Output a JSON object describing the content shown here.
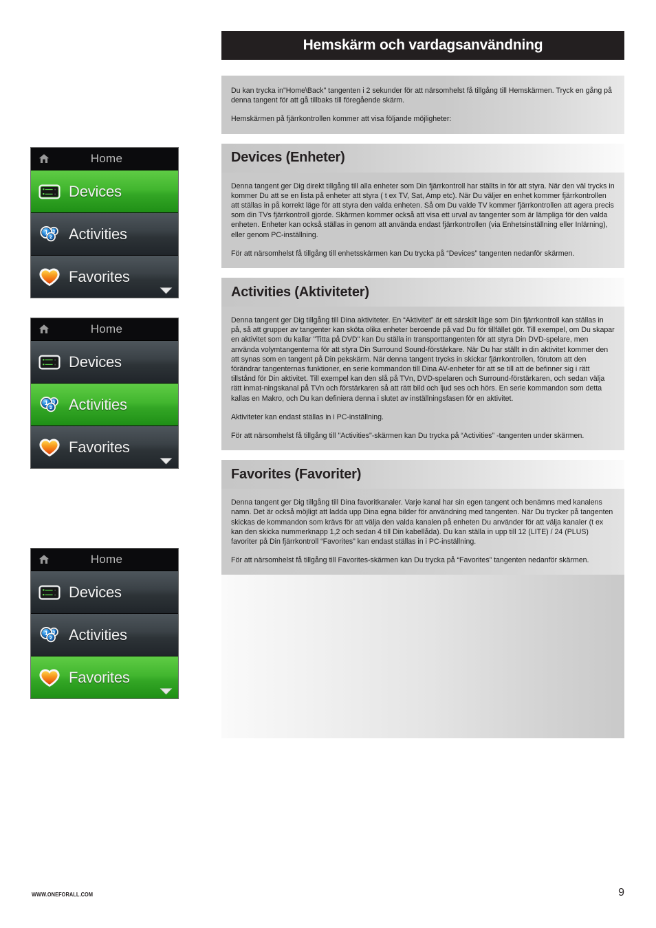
{
  "page": {
    "title": "Hemskärm och vardagsanvändning",
    "footer_url": "WWW.ONEFORALL.COM",
    "page_number": "9"
  },
  "colors": {
    "banner_bg": "#231f20",
    "panel_gray": "#c9c9c9",
    "highlight_green": "#3fb42c",
    "row_dark": "#3b4247",
    "screen_titlebar": "#0b0b0d",
    "heart_orange": "#f07c18",
    "activity_blue": "#1b7fd4",
    "led_green": "#3fd43f"
  },
  "intro": {
    "paragraphs": [
      "Du kan trycka in\"Home\\Back\"  tangenten i 2 sekunder för att närsomhelst få tillgång till Hemskärmen. Tryck en gång på denna tangent för att gå tillbaks till föregående skärm.",
      "Hemskärmen på fjärrkontrollen kommer att visa följande möjligheter:"
    ]
  },
  "sections": [
    {
      "heading": "Devices (Enheter)",
      "paragraphs": [
        "Denna tangent ger Dig direkt tillgång till alla enheter som Din fjärrkontroll har ställts in för att styra. När den väl trycks in kommer Du att se en lista på enheter att styra ( t ex TV, Sat, Amp etc). När Du väljer en enhet kommer fjärrkontrollen att ställas in på korrekt läge för att styra den valda enheten. Så om Du valde TV kommer fjärrkontrollen att agera precis som din TVs fjärrkontroll gjorde.\nSkärmen kommer också att visa ett urval av tangenter som är lämpliga för den valda enheten.\nEnheter kan också ställas in genom att använda endast fjärrkontrollen (via Enhetsinställning eller Inlärning), eller genom PC-inställning.",
        "För att närsomhelst få tillgång till enhetsskärmen kan Du trycka på “Devices”  tangenten nedanför skärmen."
      ]
    },
    {
      "heading": "Activities (Aktiviteter)",
      "paragraphs": [
        "Denna tangent ger Dig tillgång till Dina aktiviteter.\nEn “Aktivitet” är ett särskilt läge som Din fjärrkontroll kan ställas in på, så att grupper av tangenter kan sköta olika enheter beroende på vad Du för tillfället gör. Till exempel, om Du skapar en aktivitet som du kallar \"Titta på DVD\" kan Du ställa in transporttangenten för att styra Din DVD-spelare, men använda volymtangenterna för att styra Din Surround Sound-förstärkare.\nNär Du har ställt in din aktivitet kommer den att synas som en tangent på Din pekskärm. När denna tangent trycks in skickar fjärrkontrollen, förutom att den förändrar tangenternas funktioner, en serie kommandon till Dina AV-enheter för att se till att de befinner sig i rätt tillstånd för Din aktivitet. Till exempel kan den slå på TVn, DVD-spelaren och Surround-förstärkaren, och sedan välja rätt inmat-ningskanal på TVn och förstärkaren så att rätt bild och ljud ses och hörs. En serie kommandon som detta kallas en Makro, och Du kan definiera denna i slutet av inställningsfasen för en aktivitet.",
        "Aktiviteter kan endast ställas in i PC-inställning.",
        "För att närsomhelst få tillgång till \"Activities\"-skärmen kan Du trycka på “Activities”  -tangenten under skärmen."
      ]
    },
    {
      "heading": "Favorites (Favoriter)",
      "paragraphs": [
        "Denna tangent ger Dig tillgång till Dina favoritkanaler. Varje kanal har sin egen tangent och benämns med kanalens namn. Det är också möjligt att ladda upp Dina egna bilder för användning med tangenten. När Du trycker på tangenten skickas de kommandon som krävs för att välja den valda kanalen på enheten Du använder för att välja kanaler (t ex kan den skicka nummerknapp 1,2 och sedan 4 till Din kabellåda).\nDu kan ställa in upp till 12 (LITE) / 24 (PLUS) favoriter på Din fjärrkontroll\n“Favorites” kan endast ställas in i PC-inställning.",
        "För att närsomhelst få tillgång till Favorites-skärmen kan Du trycka på “Favorites”  tangenten nedanför skärmen."
      ]
    }
  ],
  "screens": [
    {
      "title": "Home",
      "selected": "Devices",
      "rows": [
        {
          "label": "Devices",
          "icon": "devices-icon"
        },
        {
          "label": "Activities",
          "icon": "activities-icon"
        },
        {
          "label": "Favorites",
          "icon": "favorites-heart-icon"
        }
      ]
    },
    {
      "title": "Home",
      "selected": "Activities",
      "rows": [
        {
          "label": "Devices",
          "icon": "devices-icon"
        },
        {
          "label": "Activities",
          "icon": "activities-icon"
        },
        {
          "label": "Favorites",
          "icon": "favorites-heart-icon"
        }
      ]
    },
    {
      "title": "Home",
      "selected": "Favorites",
      "rows": [
        {
          "label": "Devices",
          "icon": "devices-icon"
        },
        {
          "label": "Activities",
          "icon": "activities-icon"
        },
        {
          "label": "Favorites",
          "icon": "favorites-heart-icon"
        }
      ]
    }
  ]
}
